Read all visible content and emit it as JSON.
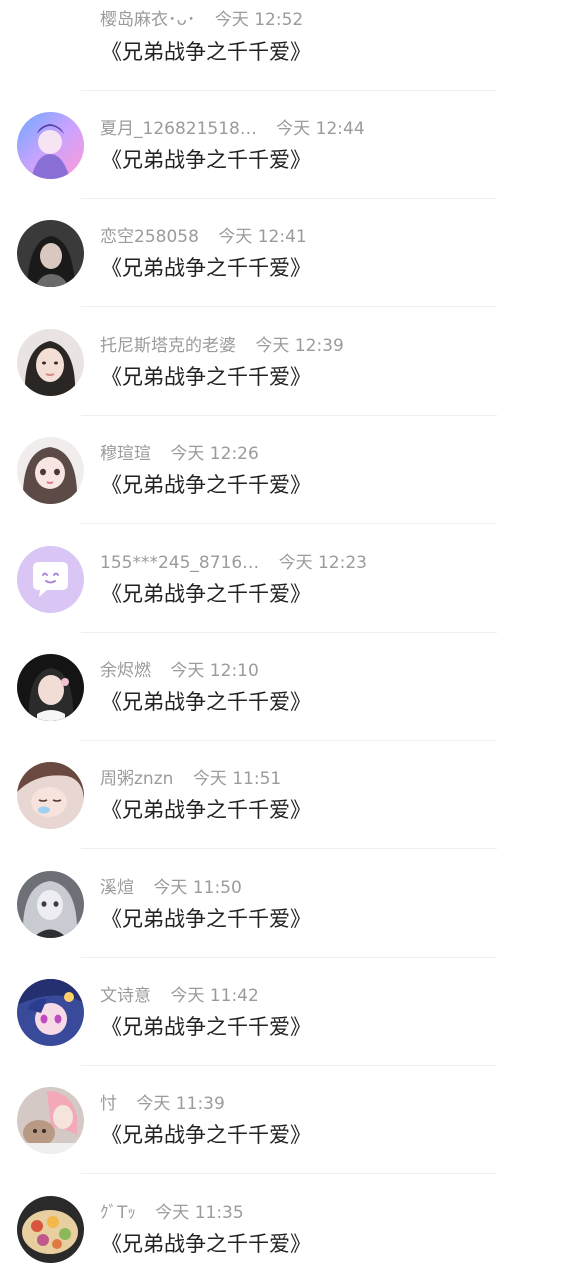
{
  "comments": [
    {
      "name": "樱岛麻衣･ᴗ･",
      "time": "今天 12:52",
      "text": "《兄弟战争之千千爱》",
      "avatar": "none"
    },
    {
      "name": "夏月_126821518…",
      "time": "今天 12:44",
      "text": "《兄弟战争之千千爱》",
      "avatar": "anime-girl-blue-pink"
    },
    {
      "name": "恋空258058",
      "time": "今天 12:41",
      "text": "《兄弟战争之千千爱》",
      "avatar": "dark-hair-gray"
    },
    {
      "name": "托尼斯塔克的老婆",
      "time": "今天 12:39",
      "text": "《兄弟战争之千千爱》",
      "avatar": "girl-portrait-light"
    },
    {
      "name": "穆瑄瑄",
      "time": "今天 12:26",
      "text": "《兄弟战争之千千爱》",
      "avatar": "doll-girl"
    },
    {
      "name": "155***245_8716…",
      "time": "今天 12:23",
      "text": "《兄弟战争之千千爱》",
      "avatar": "default-chat-bubble"
    },
    {
      "name": "余烬燃",
      "time": "今天 12:10",
      "text": "《兄弟战争之千千爱》",
      "avatar": "girl-dark-background"
    },
    {
      "name": "周粥znzn",
      "time": "今天 11:51",
      "text": "《兄弟战争之千千爱》",
      "avatar": "sleeping-girl"
    },
    {
      "name": "溪煊",
      "time": "今天 11:50",
      "text": "《兄弟战争之千千爱》",
      "avatar": "gothic-doll"
    },
    {
      "name": "文诗意",
      "time": "今天 11:42",
      "text": "《兄弟战争之千千爱》",
      "avatar": "anime-character-purple"
    },
    {
      "name": "忖",
      "time": "今天 11:39",
      "text": "《兄弟战争之千千爱》",
      "avatar": "pink-hair-cat"
    },
    {
      "name": "ｸﾞTｯ",
      "time": "今天 11:35",
      "text": "《兄弟战争之千千爱》",
      "avatar": "food-plate"
    }
  ],
  "colors": {
    "meta_text": "#9b9b9b",
    "message_text": "#222222",
    "divider": "#eeeeee",
    "default_avatar_bg": "#d9c6f5"
  }
}
